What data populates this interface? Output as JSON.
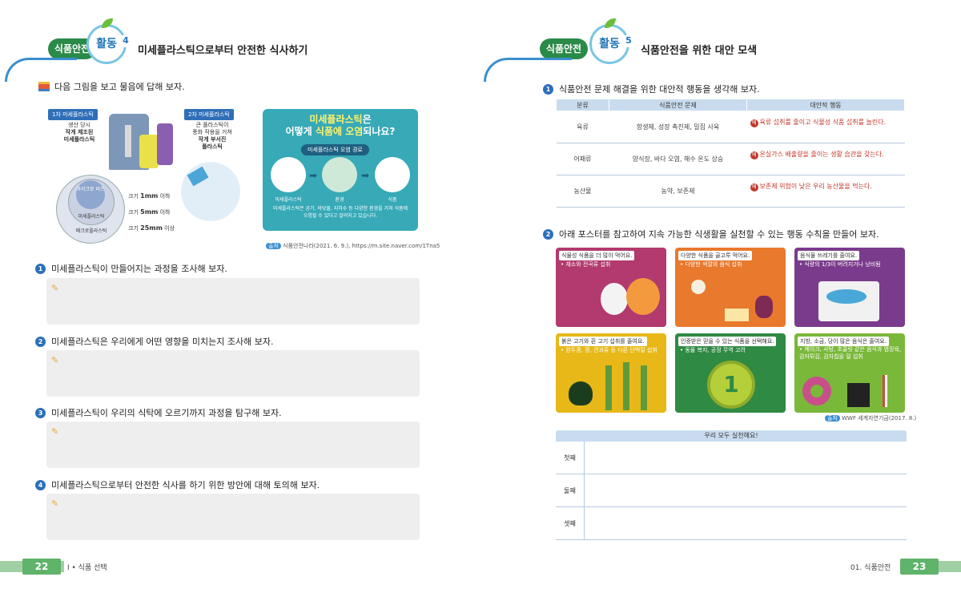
{
  "left": {
    "section_pill": "식품안전",
    "activity_word": "활동",
    "activity_num": "4",
    "title": "미세플라스틱으로부터 안전한 식사하기",
    "instruction": "다음 그림을 보고 물음에 답해 보자.",
    "figure": {
      "primary_label": "1차 미세플라스틱",
      "primary_desc": [
        "생산 당시",
        "작게 제조된",
        "미세플라스틱"
      ],
      "secondary_label": "2차 미세플라스틱",
      "secondary_desc": [
        "큰 플라스틱이",
        "풍화 작용을 거쳐",
        "작게 부서진",
        "플라스틱"
      ],
      "circles": [
        "마이크로 비즈",
        "미세플라스틱",
        "매크로플라스틱"
      ],
      "sizes": [
        {
          "prefix": "크기",
          "value": "1mm",
          "suffix": "이하"
        },
        {
          "prefix": "크기",
          "value": "5mm",
          "suffix": "이하"
        },
        {
          "prefix": "크기",
          "value": "25mm",
          "suffix": "이상"
        }
      ]
    },
    "infobox": {
      "title_line1_a": "미세플라스틱",
      "title_line1_b": "은",
      "title_line2_a": "어떻게 ",
      "title_line2_b": "식품에 오염",
      "title_line2_c": "되나요?",
      "route_label": "미세플라스틱 오염 경로",
      "stages": [
        "미세플라스틱",
        "환경",
        "식품"
      ],
      "desc": "미세플라스틱은 공기, 바닷물, 지하수 등 다양한 환경을 거쳐 식품에 오염될 수 있다고 알려지고 있습니다."
    },
    "source_tag": "출처",
    "source": "식품안전나라(2021. 6. 9.), https://m.site.naver.com/1Tna5",
    "questions": [
      {
        "num": "1",
        "text": "미세플라스틱이 만들어지는 과정을 조사해 보자."
      },
      {
        "num": "2",
        "text": "미세플라스틱은 우리에게 어떤 영향을 미치는지 조사해 보자."
      },
      {
        "num": "3",
        "text": "미세플라스틱이 우리의 식탁에 오르기까지 과정을 탐구해 보자."
      },
      {
        "num": "4",
        "text": "미세플라스틱으로부터 안전한 식사를 하기 위한 방안에 대해 토의해 보자."
      }
    ],
    "page_num": "22",
    "footer": "Ⅰ • 식품 선택"
  },
  "right": {
    "section_pill": "식품안전",
    "activity_word": "활동",
    "activity_num": "5",
    "title": "식품안전을 위한 대안 모색",
    "q1": {
      "num": "1",
      "text": "식품안전 문제 해결을 위한 대안적 행동을 생각해 보자."
    },
    "table": {
      "headers": [
        "분류",
        "식품안전 문제",
        "대안적 행동"
      ],
      "rows": [
        {
          "category": "육류",
          "problem": "항생제, 성장 촉진제, 밀집 사육",
          "action": "육류 섭취를 줄이고 식물성 식품 섭취를 늘린다."
        },
        {
          "category": "어패류",
          "problem": "양식장, 바다 오염, 해수 온도 상승",
          "action": "온실가스 배출량을 줄이는 생활 습관을 갖는다."
        },
        {
          "category": "농산물",
          "problem": "농약, 보존제",
          "action": "보존제 위험이 낮은 우리 농산물을 먹는다."
        }
      ],
      "example_tag": "예"
    },
    "q2": {
      "num": "2",
      "text": "아래 포스터를 참고하여 지속 가능한 식생활을 실천할 수 있는 행동 수칙을 만들어 보자."
    },
    "posters": [
      {
        "title": "식물성 식품을 더 많이 먹어요.",
        "sub": "• 채소와 전곡류 섭취",
        "color": "#b23a6e"
      },
      {
        "title": "다양한 식품을 골고루 먹어요.",
        "sub": "• 다양한 색깔의 음식 섭취",
        "color": "#e8792d"
      },
      {
        "title": "음식물 쓰레기를 줄여요.",
        "sub": "• 식량의 1/3이 버려지거나 낭비됨",
        "color": "#7b3b8c"
      },
      {
        "title": "붉은 고기와 흰 고기 섭취를 줄여요.",
        "sub": "• 완두콩, 콩, 견과류 등 다른 단백질 섭취",
        "color": "#e7b818"
      },
      {
        "title": "인증받은 믿을 수 있는 식품을 선택해요.",
        "sub": "• 동물 복지, 공정 무역 고려",
        "color": "#2f8a44"
      },
      {
        "title": "지방, 소금, 당이 많은 음식은 줄여요.",
        "sub": "• 케이크, 사탕, 초콜릿 같은 음식과 염장육, 감자튀김, 감자칩을 덜 섭취",
        "color": "#7ab83a"
      }
    ],
    "medal_num": "1",
    "poster_source_tag": "출처",
    "poster_source": "WWF 세계자연기금(2017. 8.)",
    "practice": {
      "header": "우리 모두 실천해요!",
      "rows": [
        "첫째",
        "둘째",
        "셋째"
      ]
    },
    "page_num": "23",
    "footer": "01. 식품안전"
  }
}
